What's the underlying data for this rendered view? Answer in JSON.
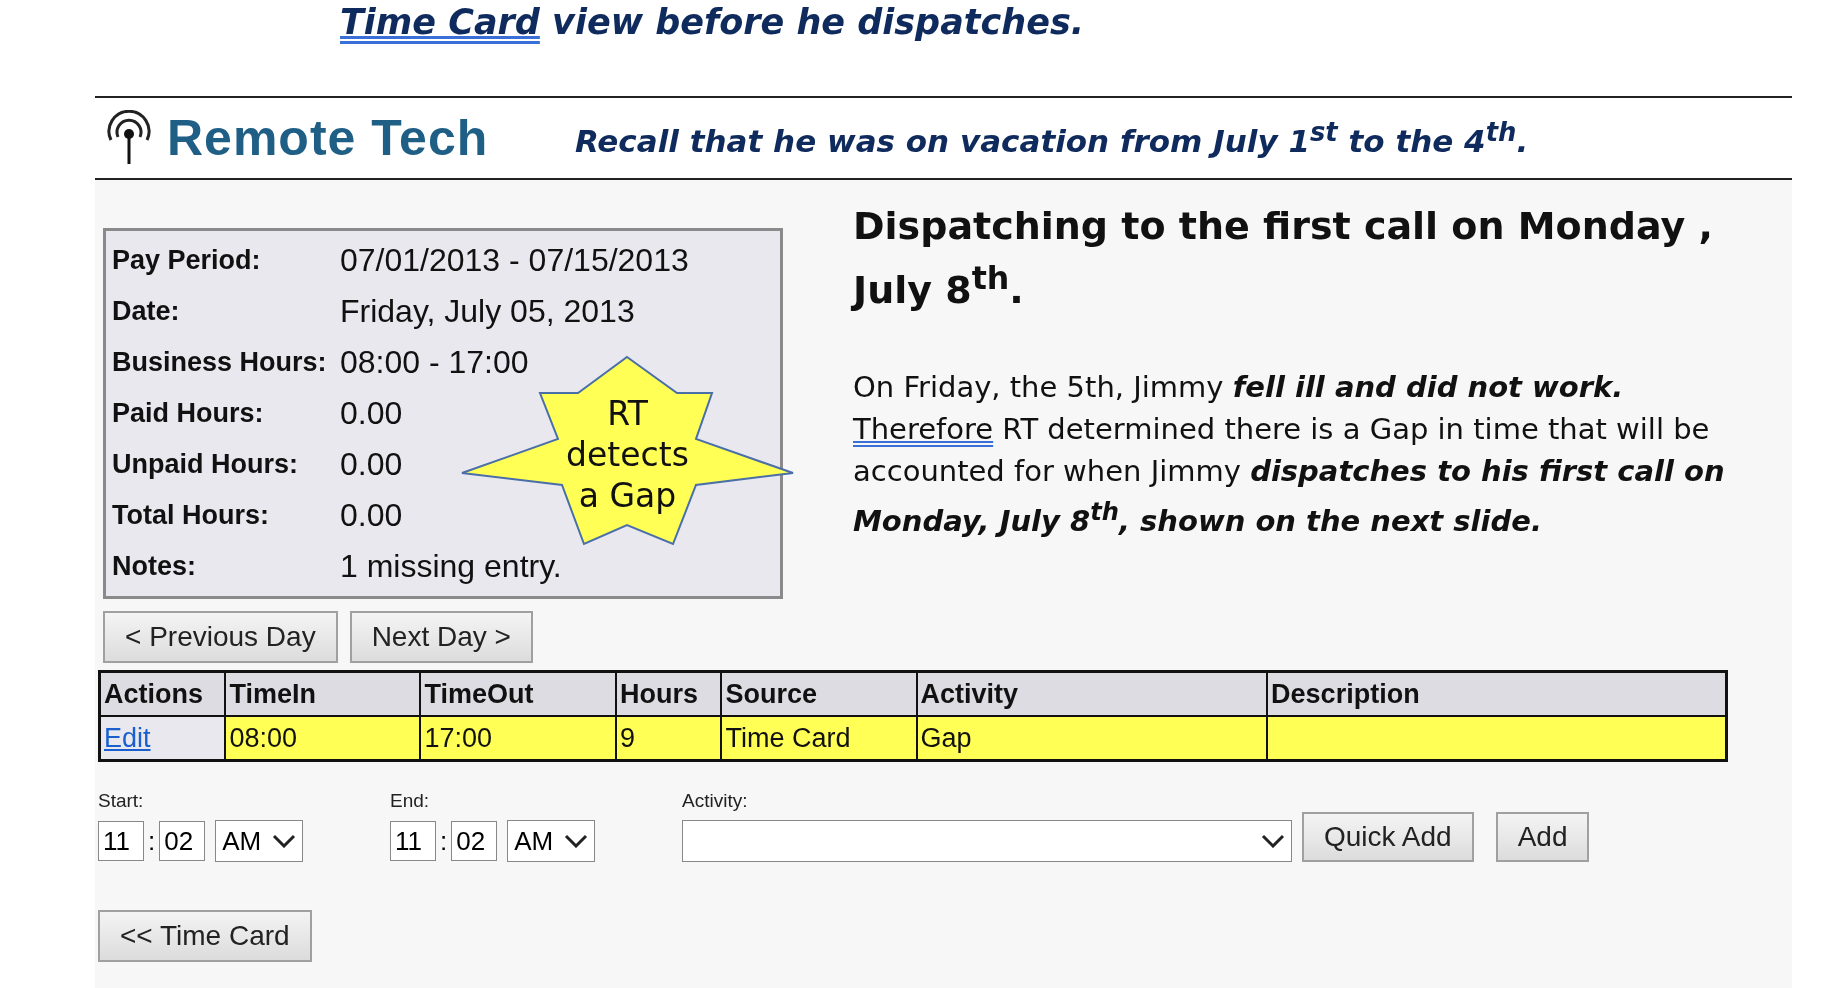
{
  "slide_title": {
    "parts": [
      {
        "text": "Time Card",
        "underline": true
      },
      {
        "text": " view before he dispatches.",
        "underline": false
      }
    ]
  },
  "app_header": {
    "logo_text": "Remote Tech",
    "note": "Recall that he was on vacation from July 1$^{st}$ to the 4$^{th}$."
  },
  "summary": [
    {
      "label": "Pay Period:",
      "value": "07/01/2013 - 07/15/2013"
    },
    {
      "label": "Date:",
      "value": "Friday, July 05, 2013"
    },
    {
      "label": "Business Hours:",
      "value": "08:00 - 17:00"
    },
    {
      "label": "Paid Hours:",
      "value": "0.00"
    },
    {
      "label": "Unpaid Hours:",
      "value": "0.00"
    },
    {
      "label": "Total Hours:",
      "value": "0.00"
    },
    {
      "label": "Notes:",
      "value": "1 missing entry."
    }
  ],
  "callout": "RT detects a Gap",
  "day_buttons": [
    "< Previous Day",
    "Next Day >"
  ],
  "table": {
    "columns": [
      "Actions",
      "TimeIn",
      "TimeOut",
      "Hours",
      "Source",
      "Activity",
      "Description"
    ],
    "rows": [
      {
        "highlighted": true,
        "cells": [
          "Edit",
          "08:00",
          "17:00",
          "9",
          "Time Card",
          "Gap",
          ""
        ]
      }
    ]
  },
  "entry_form": {
    "time_separator": ":",
    "start": {
      "label": "Start:",
      "hour": "11",
      "minute": "02",
      "ampm": "AM"
    },
    "end": {
      "label": "End:",
      "hour": "11",
      "minute": "02",
      "ampm": "AM"
    },
    "activity": {
      "label": "Activity:"
    },
    "buttons": [
      "Quick Add",
      "Add"
    ]
  },
  "back_button": "<< Time Card",
  "explanation": {
    "heading": "Dispatching to the first call on Monday , July 8$^{th}$.",
    "paragraph": [
      {
        "text": "On Friday, the 5th, Jimmy **fell ill and did not work.** ",
        "underline": false
      },
      {
        "text": "Therefore",
        "underline": true
      },
      {
        "text": " RT determined there is a Gap in time that will be accounted for when Jimmy **dispatches to his first call on Monday, July 8$^{th}$, shown on the next slide.**",
        "underline": false
      }
    ]
  }
}
